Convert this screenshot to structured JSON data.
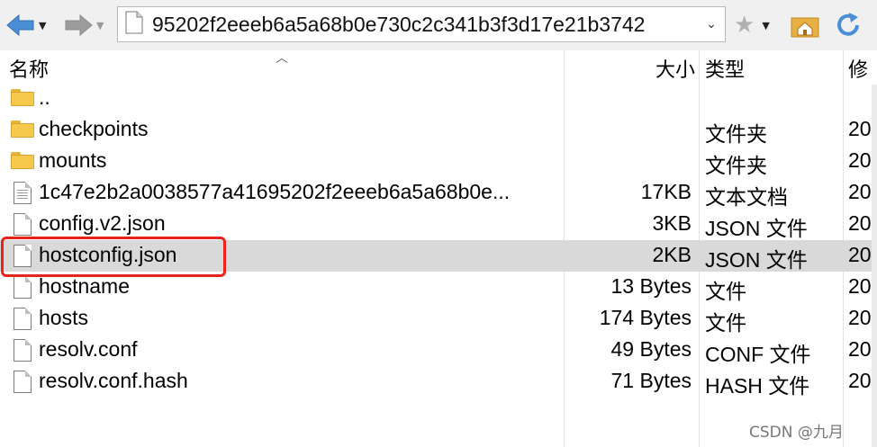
{
  "toolbar": {
    "path": "95202f2eeeb6a5a68b0e730c2c341b3f3d17e21b3742"
  },
  "header": {
    "name": "名称",
    "size": "大小",
    "type": "类型",
    "modified": "修"
  },
  "files": [
    {
      "icon": "folder",
      "name": "..",
      "size": "",
      "type": "",
      "modified": ""
    },
    {
      "icon": "folder",
      "name": "checkpoints",
      "size": "",
      "type": "文件夹",
      "modified": "20"
    },
    {
      "icon": "folder",
      "name": "mounts",
      "size": "",
      "type": "文件夹",
      "modified": "20"
    },
    {
      "icon": "text-file",
      "name": "1c47e2b2a0038577a41695202f2eeeb6a5a68b0e...",
      "size": "17KB",
      "type": "文本文档",
      "modified": "20"
    },
    {
      "icon": "file",
      "name": "config.v2.json",
      "size": "3KB",
      "type": "JSON 文件",
      "modified": "20"
    },
    {
      "icon": "file",
      "name": "hostconfig.json",
      "size": "2KB",
      "type": "JSON 文件",
      "modified": "20"
    },
    {
      "icon": "file",
      "name": "hostname",
      "size": "13 Bytes",
      "type": "文件",
      "modified": "20"
    },
    {
      "icon": "file",
      "name": "hosts",
      "size": "174 Bytes",
      "type": "文件",
      "modified": "20"
    },
    {
      "icon": "file",
      "name": "resolv.conf",
      "size": "49 Bytes",
      "type": "CONF 文件",
      "modified": "20"
    },
    {
      "icon": "file",
      "name": "resolv.conf.hash",
      "size": "71 Bytes",
      "type": "HASH 文件",
      "modified": "20"
    }
  ],
  "watermark": "CSDN @九月",
  "colors": {
    "selected_row": "#d9d9d9",
    "highlight_border": "#e8241b",
    "folder": "#f6c84c"
  }
}
